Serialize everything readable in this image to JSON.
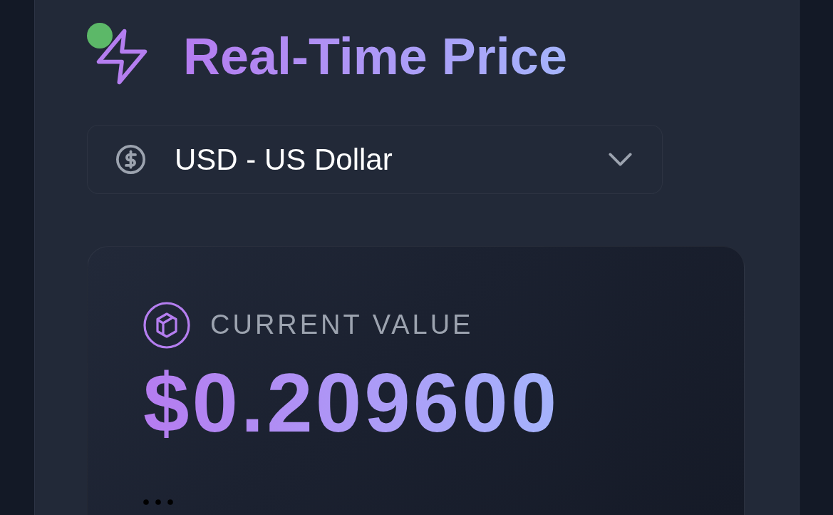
{
  "header": {
    "title": "Real-Time Price",
    "connected": true
  },
  "currency_select": {
    "value": "USD - US Dollar"
  },
  "price_card": {
    "label": "CURRENT VALUE",
    "value": "$0.209600"
  }
}
